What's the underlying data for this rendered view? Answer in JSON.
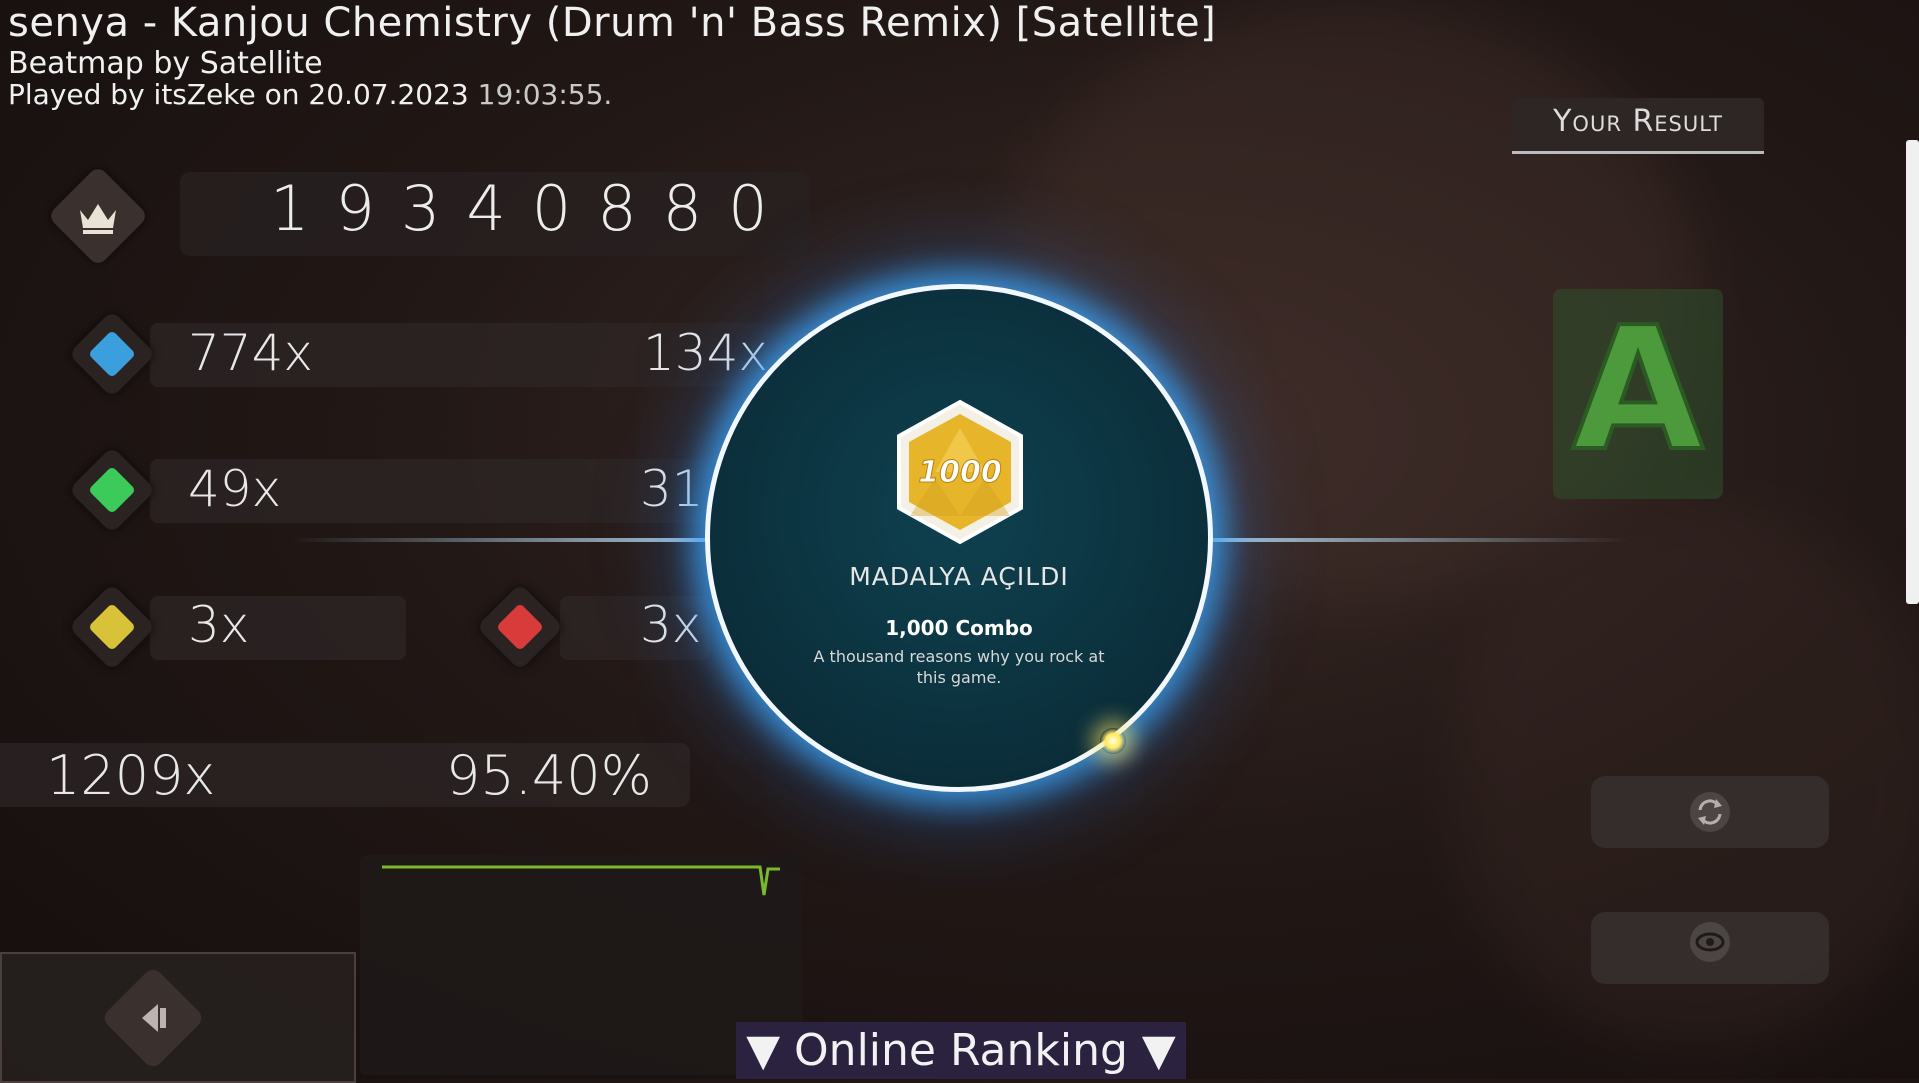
{
  "header": {
    "title": "senya - Kanjou Chemistry (Drum 'n' Bass Remix) [Satellite]",
    "beatmap_by": "Beatmap by Satellite",
    "played_prefix": "Played by itsZeke on 20.07.2023",
    "played_time": "19:03:55."
  },
  "score": {
    "value": "19340880",
    "icon": "crown-icon"
  },
  "hits": {
    "great": {
      "count": "774x",
      "color": "#3a9fdc",
      "geki": "134x"
    },
    "good": {
      "count": "49x",
      "color": "#3ccb5a",
      "katu": "31"
    },
    "meh": {
      "count": "3x",
      "color": "#d8c23a"
    },
    "miss": {
      "count": "3x",
      "color": "#d93b3b"
    }
  },
  "combo": "1209x",
  "accuracy": "95.40%",
  "medal": {
    "heading": "MADALYA AÇILDI",
    "badge": "1000",
    "name": "1,000 Combo",
    "description": "A thousand reasons why you rock at this game."
  },
  "result": {
    "tab_label": "Your Result",
    "grade": "A",
    "grade_color": "#4c9a3c"
  },
  "buttons": {
    "retry_icon": "retry-icon",
    "watch_icon": "eye-icon",
    "back_icon": "back-arrow-icon"
  },
  "online_ranking": {
    "label": "▼ Online Ranking ▼"
  }
}
